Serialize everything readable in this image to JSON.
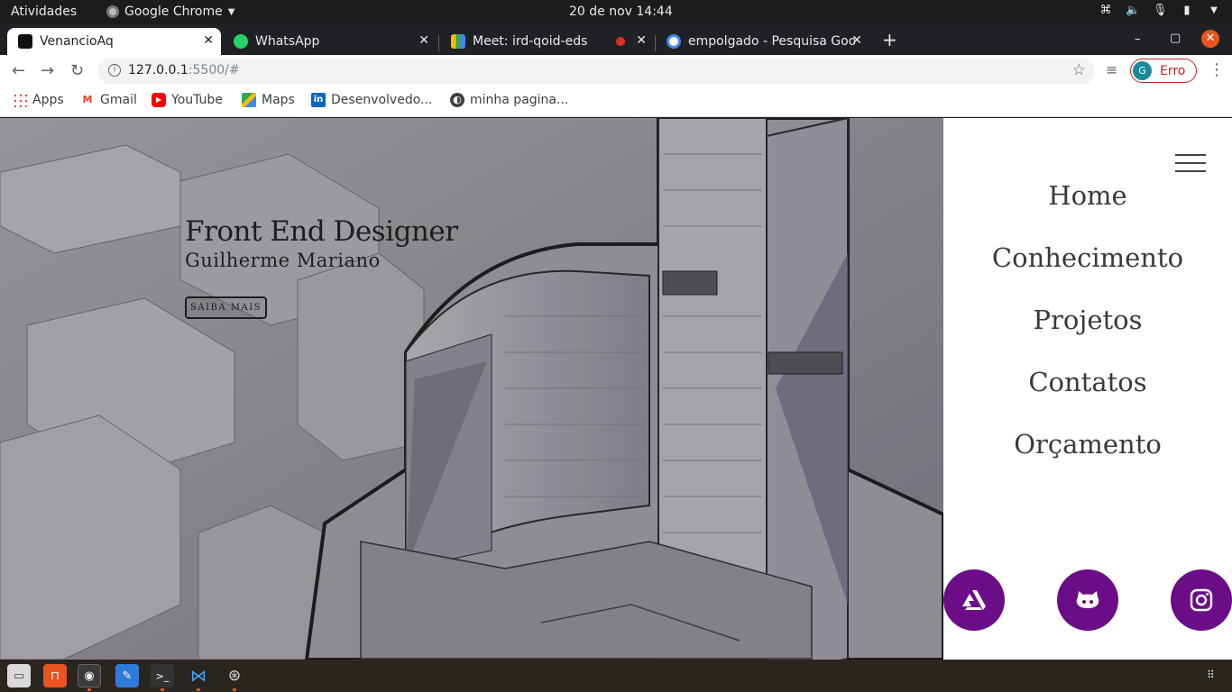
{
  "system_bar": {
    "activities": "Atividades",
    "app_name": "Google Chrome",
    "clock": "20 de nov  14:44"
  },
  "tabs": [
    {
      "title": "VenancioAq",
      "active": true
    },
    {
      "title": "WhatsApp",
      "active": false
    },
    {
      "title": "Meet: ird-qoid-eds",
      "active": false
    },
    {
      "title": "empolgado - Pesquisa Goo",
      "active": false
    }
  ],
  "address_bar": {
    "host": "127.0.0.1",
    "path": ":5500/#"
  },
  "profile": {
    "initial": "G",
    "status": "Erro"
  },
  "bookmarks": [
    {
      "label": "Apps",
      "icon": "apps-grid-icon"
    },
    {
      "label": "Gmail",
      "icon": "gmail-icon"
    },
    {
      "label": "YouTube",
      "icon": "youtube-icon"
    },
    {
      "label": "Maps",
      "icon": "maps-icon"
    },
    {
      "label": "Desenvolvedo...",
      "icon": "linkedin-icon"
    },
    {
      "label": "minha pagina...",
      "icon": "globe-icon"
    }
  ],
  "hero": {
    "title": "Front End Designer",
    "subtitle": "Guilherme Mariano",
    "button": "SAIBA MAIS"
  },
  "nav": {
    "items": [
      "Home",
      "Conhecimento",
      "Projetos",
      "Contatos",
      "Orçamento"
    ]
  },
  "social": [
    {
      "icon": "artstation-icon"
    },
    {
      "icon": "github-icon"
    },
    {
      "icon": "instagram-icon"
    }
  ],
  "colors": {
    "accent_purple": "#6b0d86",
    "ubuntu_orange": "#e95420",
    "profile_error": "#c5221f"
  }
}
